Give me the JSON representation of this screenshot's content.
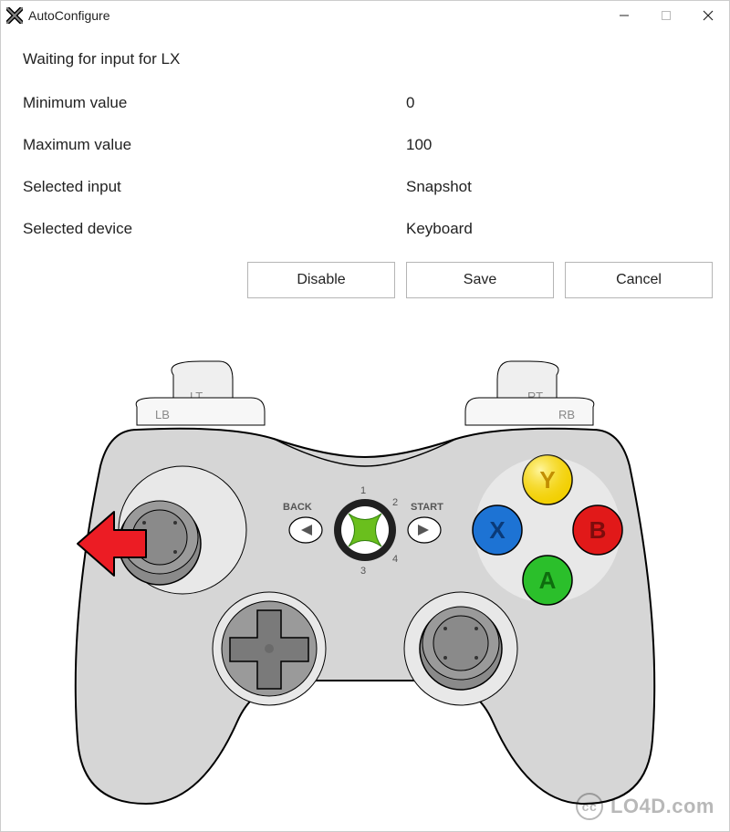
{
  "window": {
    "title": "AutoConfigure"
  },
  "status": {
    "prefix": "Waiting for input for ",
    "axis": "LX"
  },
  "fields": {
    "min_label": "Minimum value",
    "min_value": "0",
    "max_label": "Maximum value",
    "max_value": "100",
    "selected_input_label": "Selected input",
    "selected_input_value": "Snapshot",
    "selected_device_label": "Selected device",
    "selected_device_value": "Keyboard"
  },
  "buttons": {
    "disable": "Disable",
    "save": "Save",
    "cancel": "Cancel"
  },
  "controller": {
    "lt": "LT",
    "lb": "LB",
    "rt": "RT",
    "rb": "RB",
    "back": "BACK",
    "start": "START",
    "y": "Y",
    "x": "X",
    "b": "B",
    "a": "A",
    "n1": "1",
    "n2": "2",
    "n3": "3",
    "n4": "4",
    "highlighted_axis": "LX"
  },
  "watermark": {
    "text": "LO4D.com"
  }
}
